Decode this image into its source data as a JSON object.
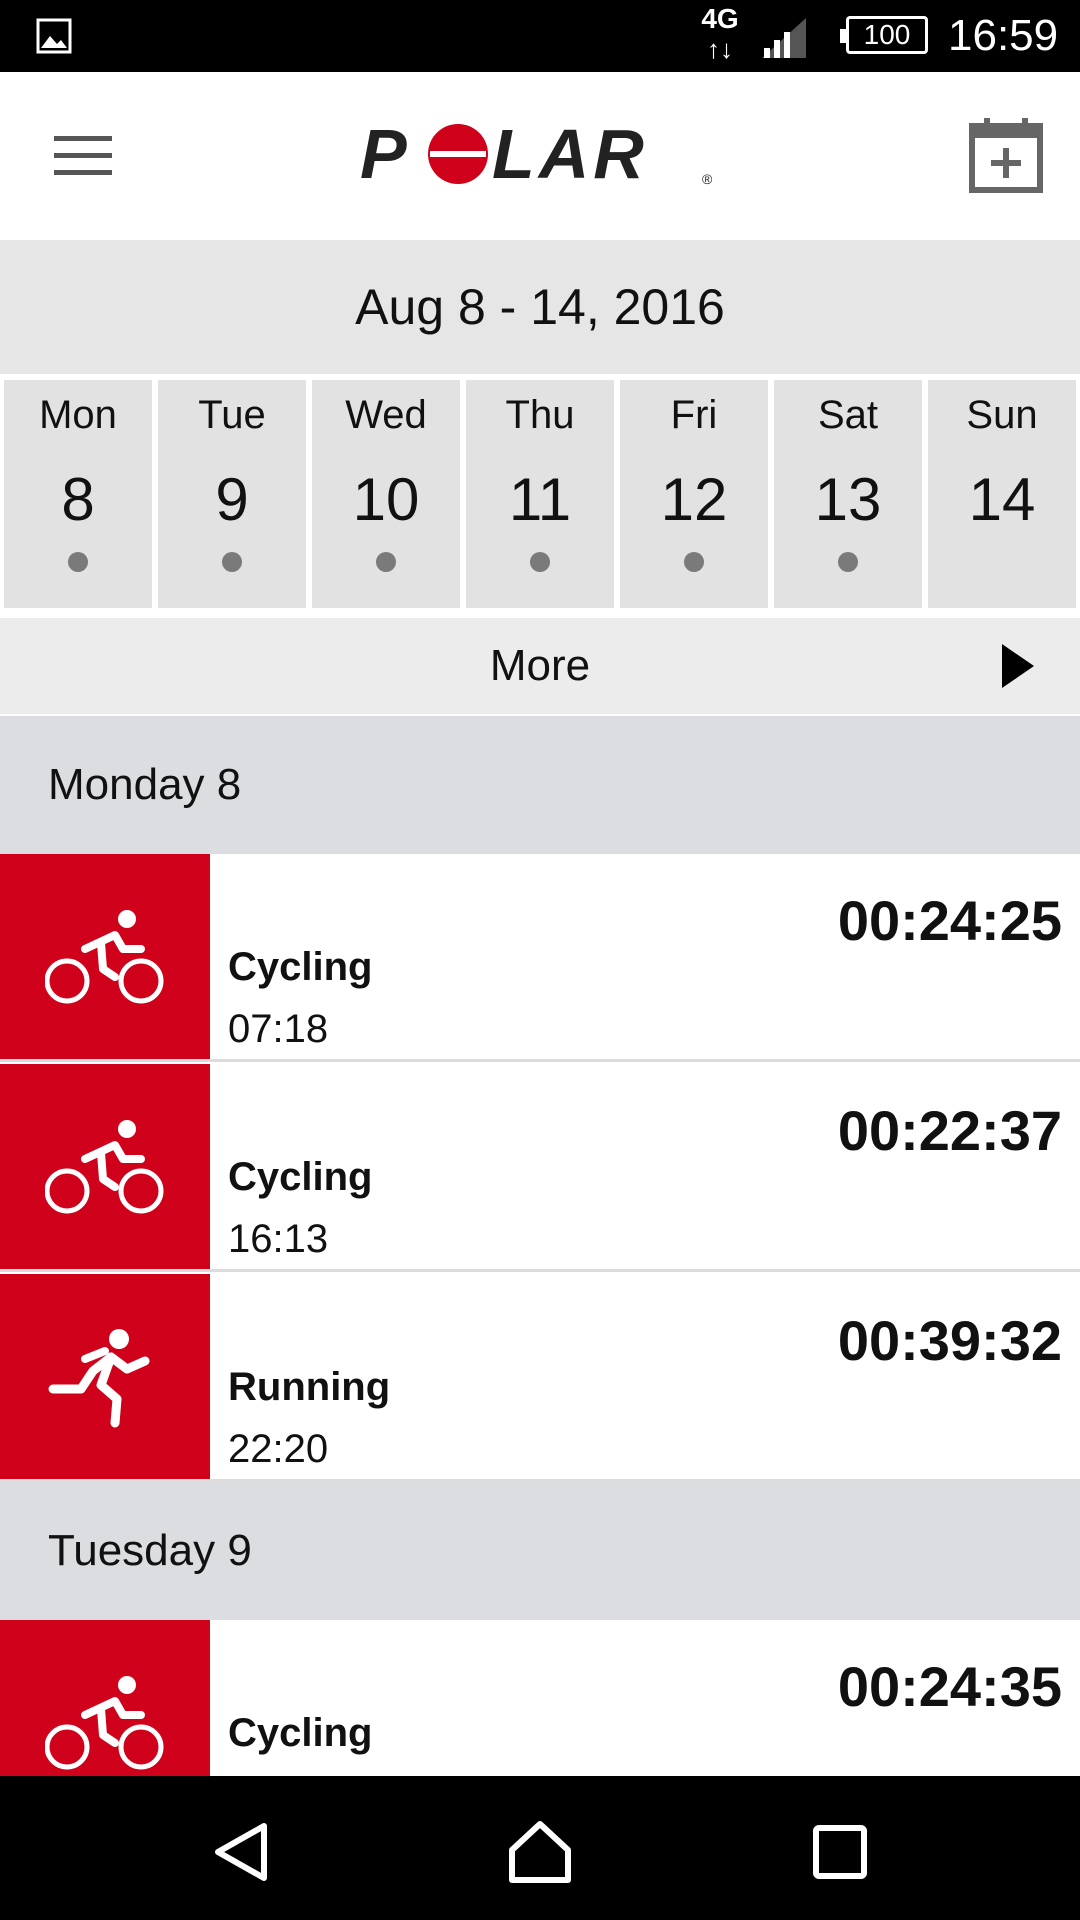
{
  "status_bar": {
    "network": "4G",
    "battery": "100",
    "time": "16:59",
    "icons": [
      "gallery-icon",
      "data-arrows-icon",
      "signal-icon",
      "battery-icon"
    ]
  },
  "header": {
    "logo_text": "POLAR",
    "icons": [
      "menu-icon",
      "add-calendar-icon"
    ]
  },
  "week": {
    "range": "Aug 8 - 14, 2016",
    "days": [
      {
        "name": "Mon",
        "num": "8",
        "has_training": true
      },
      {
        "name": "Tue",
        "num": "9",
        "has_training": true
      },
      {
        "name": "Wed",
        "num": "10",
        "has_training": true
      },
      {
        "name": "Thu",
        "num": "11",
        "has_training": true
      },
      {
        "name": "Fri",
        "num": "12",
        "has_training": true
      },
      {
        "name": "Sat",
        "num": "13",
        "has_training": true
      },
      {
        "name": "Sun",
        "num": "14",
        "has_training": false
      }
    ],
    "more_label": "More"
  },
  "sessions": {
    "groups": [
      {
        "title": "Monday 8",
        "items": [
          {
            "sport": "Cycling",
            "start": "07:18",
            "duration": "00:24:25",
            "icon": "cycling-icon"
          },
          {
            "sport": "Cycling",
            "start": "16:13",
            "duration": "00:22:37",
            "icon": "cycling-icon"
          },
          {
            "sport": "Running",
            "start": "22:20",
            "duration": "00:39:32",
            "icon": "running-icon"
          }
        ]
      },
      {
        "title": "Tuesday 9",
        "items": [
          {
            "sport": "Cycling",
            "start": "",
            "duration": "00:24:35",
            "icon": "cycling-icon"
          }
        ]
      }
    ]
  },
  "colors": {
    "brand_red": "#d0021b",
    "section_bg": "#dcdde0",
    "day_bg": "#e2e2e2"
  },
  "nav_bar": {
    "icons": [
      "back-icon",
      "home-icon",
      "recents-icon"
    ]
  }
}
